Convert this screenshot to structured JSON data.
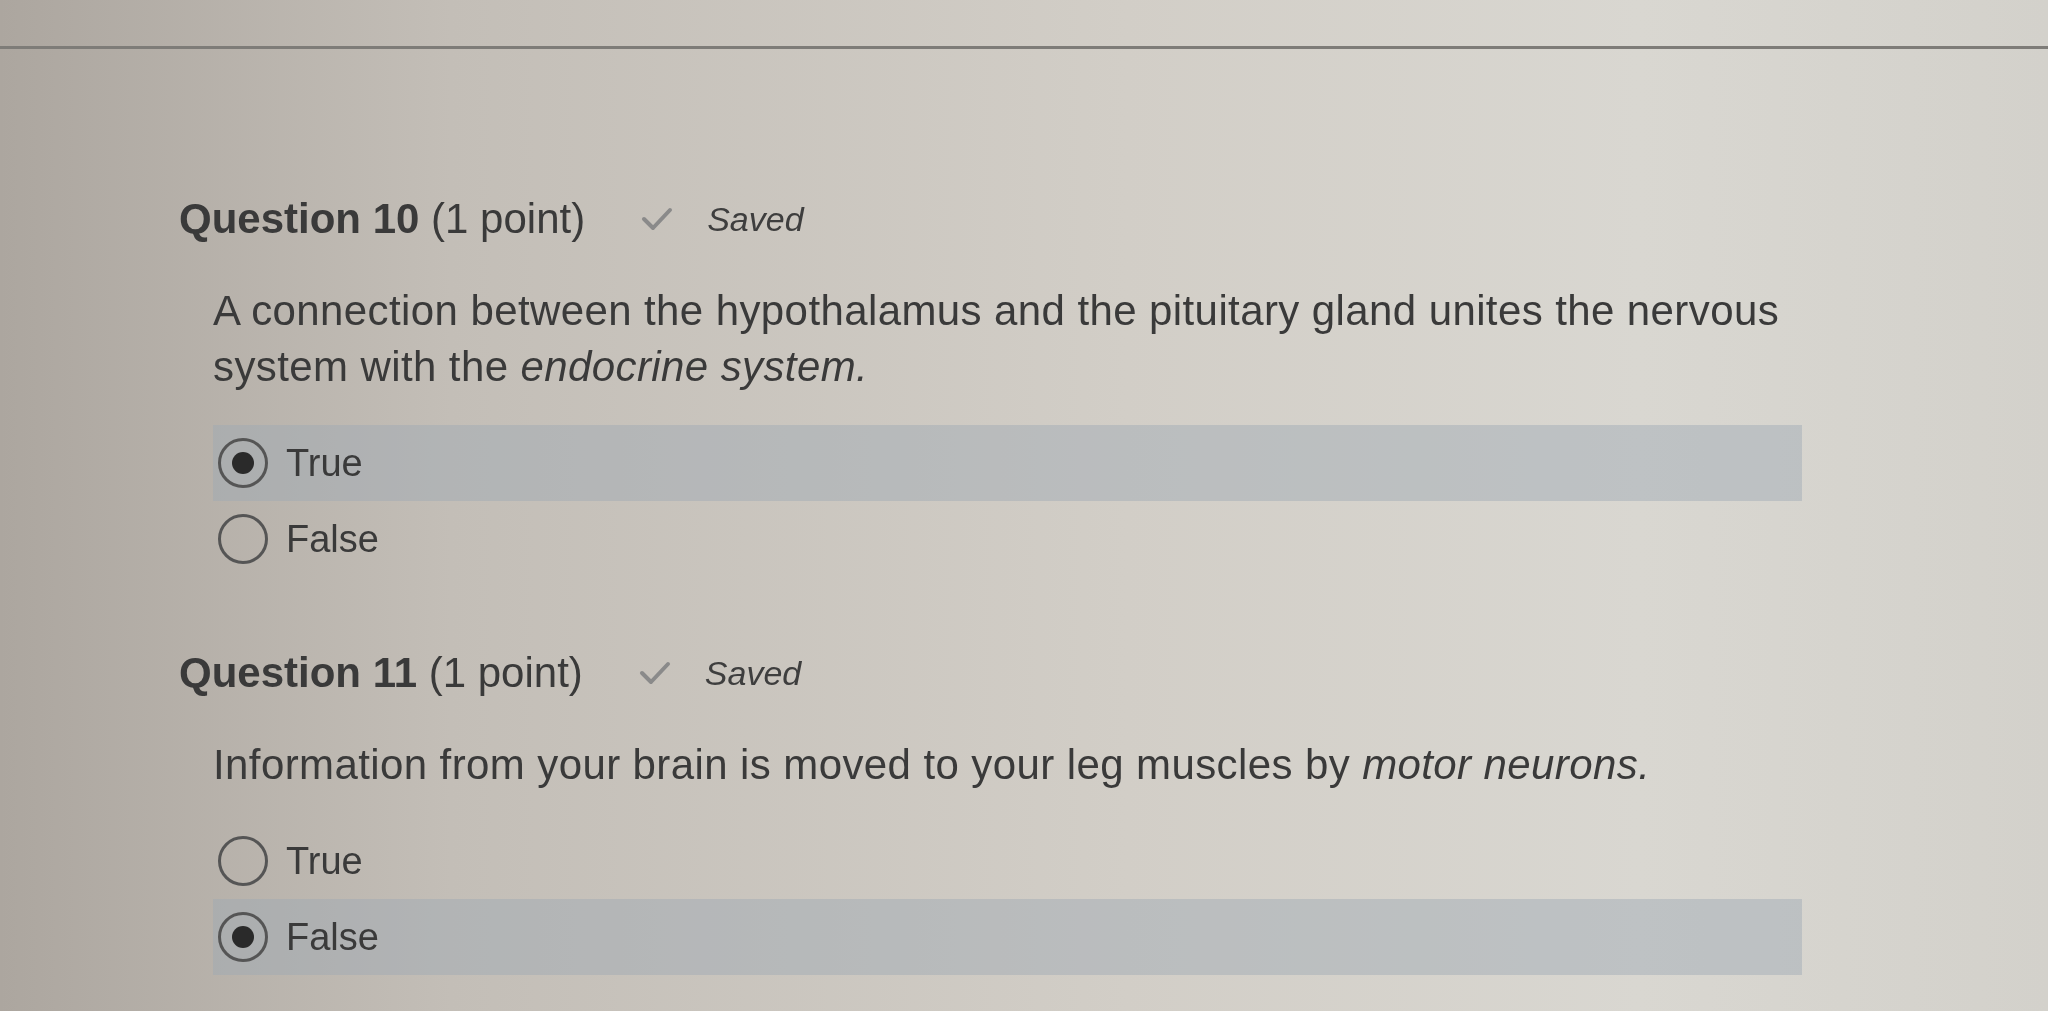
{
  "questions": [
    {
      "title": "**Question 10** (1 point)",
      "status": "Saved",
      "prompt": "A connection between the hypothalamus and the pituitary gland unites the nervous system with the *endocrine system.*",
      "options": [
        {
          "label": "True",
          "selected": true
        },
        {
          "label": "False",
          "selected": false
        }
      ]
    },
    {
      "title": "**Question 11** (1 point)",
      "status": "Saved",
      "prompt": "Information from your brain is moved to your leg muscles by *motor neurons.*",
      "options": [
        {
          "label": "True",
          "selected": false
        },
        {
          "label": "False",
          "selected": true
        }
      ]
    }
  ]
}
